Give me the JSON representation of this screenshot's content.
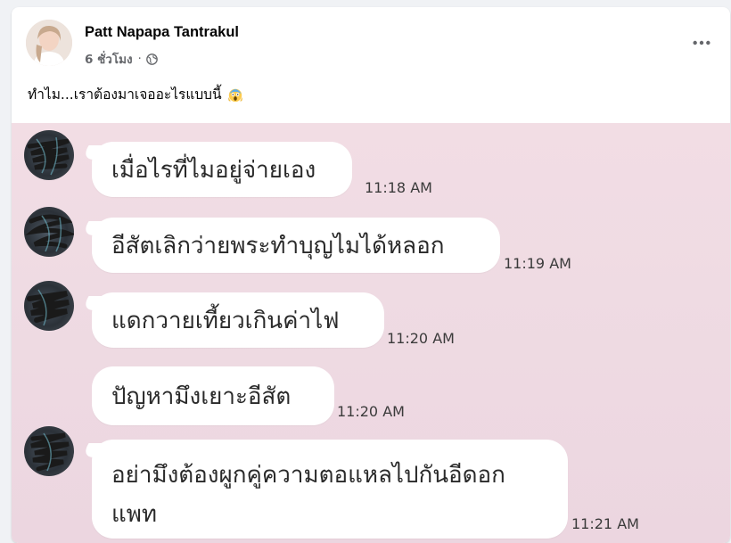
{
  "post": {
    "author": "Patt Napapa Tantrakul",
    "time": "6 ชั่วโมง",
    "separator": "·",
    "privacy_icon": "globe-icon",
    "more_icon": "more-options-icon",
    "caption": "ทำไม...เราต้องมาเจออะไรแบบนี้",
    "caption_emoji": "screaming-face-emoji"
  },
  "chat": {
    "messages": [
      {
        "text": "เมื่อไรที่ไมอยู่จ่ายเอง",
        "time": "11:18 AM",
        "has_avatar": true
      },
      {
        "text": "อีสัตเลิกว่ายพระทำบุญไมได้หลอก",
        "time": "11:19 AM",
        "has_avatar": true
      },
      {
        "text": "แดกวายเที้ยวเกินค่าไฟ",
        "time": "11:20 AM",
        "has_avatar": true
      },
      {
        "text": "ปัญหามึงเยาะอีสัต",
        "time": "11:20 AM",
        "has_avatar": false
      },
      {
        "text_line1": "อย่ามึงต้องผูกคู่ความตอแหลไปกันอีดอก",
        "text_line2": "แพท",
        "time": "11:21 AM",
        "has_avatar": true
      }
    ]
  }
}
